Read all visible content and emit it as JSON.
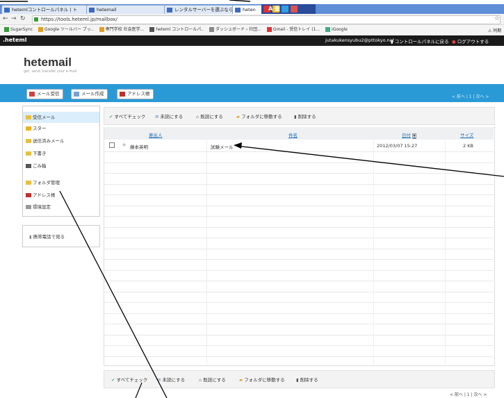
{
  "browser": {
    "tabs": [
      {
        "label": "hetemlコントロールパネル | ト"
      },
      {
        "label": "hetemail"
      },
      {
        "label": "レンタルサーバーを選ぶならヘテ"
      },
      {
        "label": "heten"
      }
    ],
    "tray_text": "A 般",
    "url": "https://tools.heteml.jp/mailbox/",
    "bookmarks": [
      "SugarSync",
      "Google ツールバー ブッ..",
      "専門学校 社会医学...",
      "heteml コントロールパ..",
      "ダッシュボード ‹ 社団...",
      "Gmail - 受信トレイ (1...",
      "iGoogle"
    ],
    "bookmark_right": "同期"
  },
  "app": {
    "brand_small": ".heteml",
    "user": "jutakukensyubu2@pttokyo.net",
    "back_to_panel": "コントロールパネルに戻る",
    "logout": "ログアウトする",
    "logo": "hetemail",
    "tagline": "get, send, transfer your e-mail"
  },
  "toolbar": {
    "receive": "メール受信",
    "compose": "メール作成",
    "address_book": "アドレス帳",
    "pager": "< 前へ | 1 | 次へ >"
  },
  "sidebar": {
    "items": [
      {
        "label": "受信メール"
      },
      {
        "label": "スター"
      },
      {
        "label": "送信済みメール"
      },
      {
        "label": "下書き"
      },
      {
        "label": "ごみ箱"
      },
      {
        "label": "フォルダ管理"
      },
      {
        "label": "アドレス帳"
      },
      {
        "label": "環境設定"
      }
    ],
    "mobile": "携帯電話で見る"
  },
  "actions": {
    "check_all": "すべてチェック",
    "mark_unread": "未読にする",
    "mark_read": "既読にする",
    "move_folder": "フォルダに移動する",
    "delete": "削除する"
  },
  "table": {
    "columns": {
      "from": "差出人",
      "subject": "件名",
      "date": "日付",
      "size": "サイズ"
    },
    "rows": [
      {
        "from": "藤本英明",
        "subject": "試験メール",
        "date": "2012/03/07 15:27",
        "size": "2 KB"
      }
    ]
  },
  "pager_bottom": "< 前へ | 1 | 次へ >"
}
